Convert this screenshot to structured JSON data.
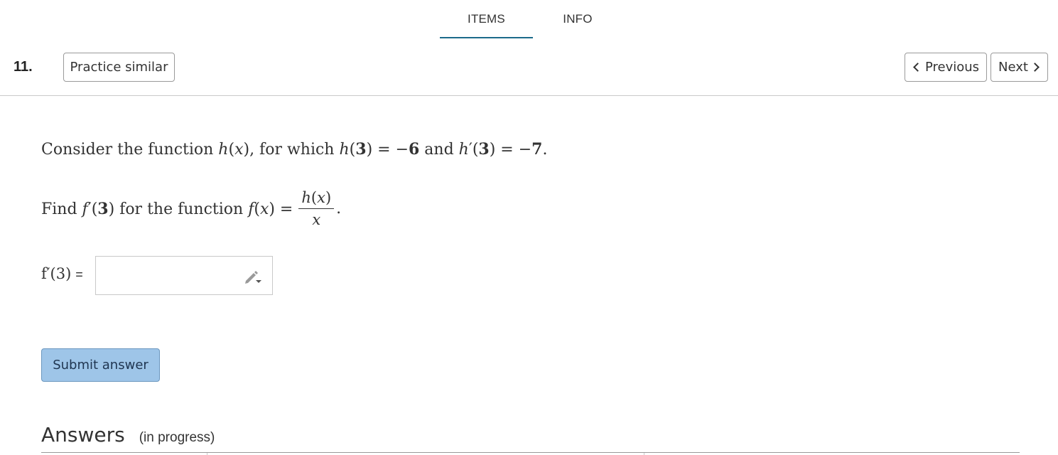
{
  "tabs": [
    {
      "label": "ITEMS",
      "active": true
    },
    {
      "label": "INFO",
      "active": false
    }
  ],
  "question": {
    "number": "11.",
    "practice_label": "Practice similar",
    "prev_label": "Previous",
    "next_label": "Next"
  },
  "problem": {
    "line1_text": "Consider the function h(x), for which h(3) = −6 and h′(3) = −7.",
    "line2_text": "Find f′(3) for the function f(x) = h(x)/x."
  },
  "answer": {
    "label": "f′(3)",
    "equals": "=",
    "value": "",
    "input_icon": "pencil-dropdown-icon"
  },
  "submit_label": "Submit answer",
  "answers_section": {
    "title": "Answers",
    "status": "(in progress)"
  },
  "colors": {
    "tab_underline": "#1b6a8a",
    "submit_bg": "#9ec5e8",
    "border": "#c9c9c9"
  }
}
